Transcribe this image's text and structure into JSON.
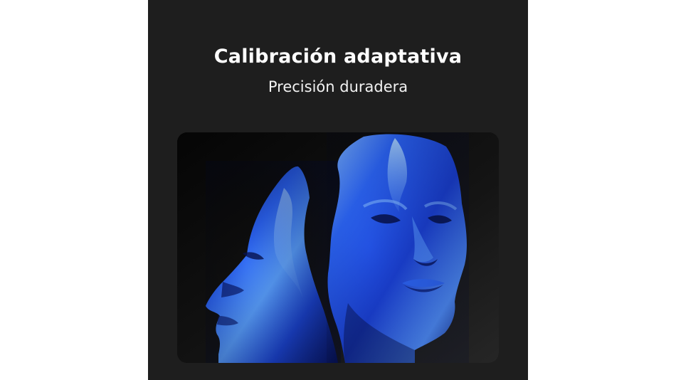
{
  "header": {
    "title": "Calibración adaptativa",
    "subtitle": "Precisión duradera"
  },
  "image": {
    "subject": "blue-metallic-faces",
    "colors": {
      "panel": "#1e1e1e",
      "face_blue": "#1f4fe0",
      "face_highlight": "#8fc3ff",
      "face_shadow": "#07124a"
    }
  }
}
